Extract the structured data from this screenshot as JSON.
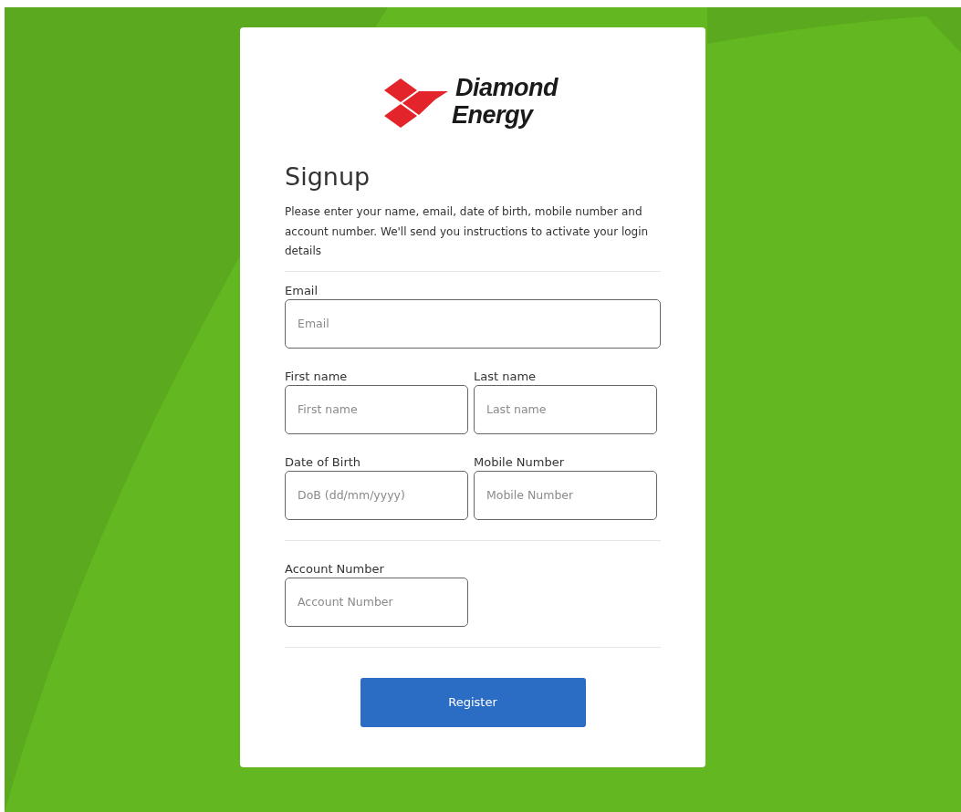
{
  "logo": {
    "lines": [
      "Diamond",
      "Energy"
    ]
  },
  "title": "Signup",
  "intro": "Please enter your name, email, date of birth, mobile number and account number. We'll send you instructions to activate your login details",
  "groups": [
    {
      "rows": [
        [
          {
            "label": "Email",
            "placeholder": "Email",
            "kind": "wide"
          }
        ],
        [
          {
            "label": "First name",
            "placeholder": "First name",
            "kind": "narrow"
          },
          {
            "label": "Last name",
            "placeholder": "Last name",
            "kind": "narrow"
          }
        ],
        [
          {
            "label": "Date of Birth",
            "placeholder": "DoB (dd/mm/yyyy)",
            "kind": "narrow"
          },
          {
            "label": "Mobile Number",
            "placeholder": "Mobile Number",
            "kind": "narrow"
          }
        ]
      ]
    },
    {
      "rows": [
        [
          {
            "label": "Account Number",
            "placeholder": "Account Number",
            "kind": "narrow"
          }
        ]
      ]
    }
  ],
  "submit": "Register"
}
